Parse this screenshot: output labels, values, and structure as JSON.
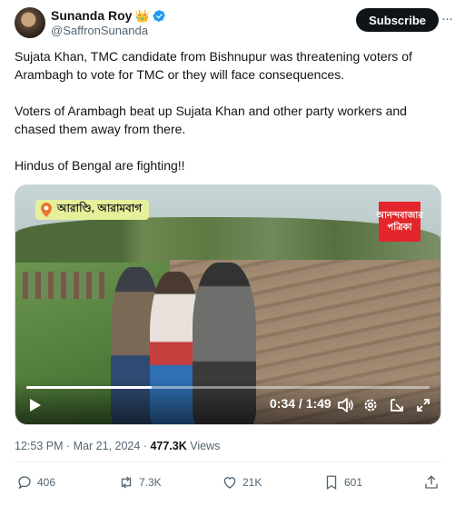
{
  "author": {
    "display_name": "Sunanda Roy",
    "crown": "👑",
    "handle": "@SaffronSunanda"
  },
  "subscribe_label": "Subscribe",
  "more_label": "···",
  "tweet": {
    "paragraphs": [
      "Sujata Khan, TMC candidate from Bishnupur was threatening voters of Arambagh to vote for TMC or they will face consequences.",
      "Voters of Arambagh beat up Sujata Khan and other party workers and chased them away from there.",
      "Hindus of Bengal are fighting!!"
    ]
  },
  "video": {
    "location_tag": "আরাণ্ডি, আরামবাগ",
    "logo_line1": "আনন্দবাজার",
    "logo_line2": "পত্রিকা",
    "time": "0:34 / 1:49",
    "progress": 0.31
  },
  "meta": {
    "time": "12:53 PM",
    "separator": "·",
    "date": "Mar 21, 2024",
    "views_count": "477.3K",
    "views_label": "Views"
  },
  "actions": {
    "replies": "406",
    "reposts": "7.3K",
    "likes": "21K",
    "bookmarks": "601"
  },
  "colors": {
    "accent": "#1d9bf0",
    "text": "#0f1419",
    "muted": "#536471"
  }
}
